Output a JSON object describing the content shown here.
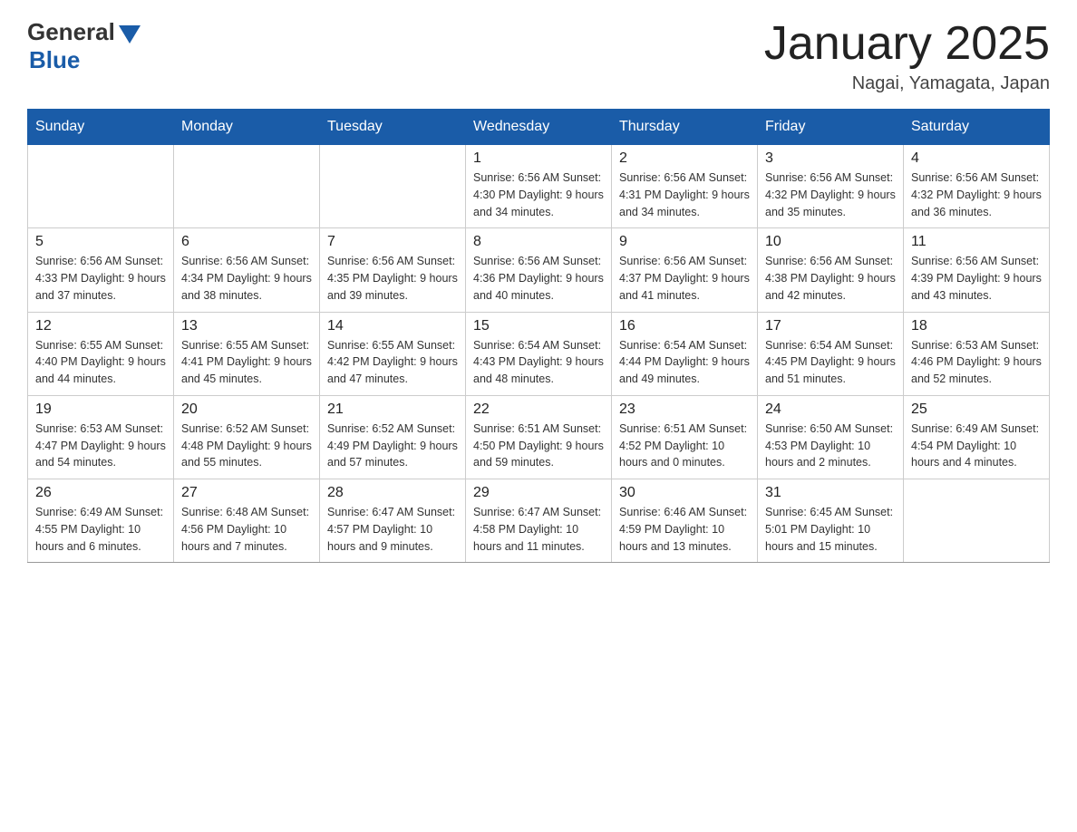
{
  "header": {
    "logo_general": "General",
    "logo_blue": "Blue",
    "title": "January 2025",
    "location": "Nagai, Yamagata, Japan"
  },
  "weekdays": [
    "Sunday",
    "Monday",
    "Tuesday",
    "Wednesday",
    "Thursday",
    "Friday",
    "Saturday"
  ],
  "weeks": [
    [
      {
        "day": "",
        "info": ""
      },
      {
        "day": "",
        "info": ""
      },
      {
        "day": "",
        "info": ""
      },
      {
        "day": "1",
        "info": "Sunrise: 6:56 AM\nSunset: 4:30 PM\nDaylight: 9 hours\nand 34 minutes."
      },
      {
        "day": "2",
        "info": "Sunrise: 6:56 AM\nSunset: 4:31 PM\nDaylight: 9 hours\nand 34 minutes."
      },
      {
        "day": "3",
        "info": "Sunrise: 6:56 AM\nSunset: 4:32 PM\nDaylight: 9 hours\nand 35 minutes."
      },
      {
        "day": "4",
        "info": "Sunrise: 6:56 AM\nSunset: 4:32 PM\nDaylight: 9 hours\nand 36 minutes."
      }
    ],
    [
      {
        "day": "5",
        "info": "Sunrise: 6:56 AM\nSunset: 4:33 PM\nDaylight: 9 hours\nand 37 minutes."
      },
      {
        "day": "6",
        "info": "Sunrise: 6:56 AM\nSunset: 4:34 PM\nDaylight: 9 hours\nand 38 minutes."
      },
      {
        "day": "7",
        "info": "Sunrise: 6:56 AM\nSunset: 4:35 PM\nDaylight: 9 hours\nand 39 minutes."
      },
      {
        "day": "8",
        "info": "Sunrise: 6:56 AM\nSunset: 4:36 PM\nDaylight: 9 hours\nand 40 minutes."
      },
      {
        "day": "9",
        "info": "Sunrise: 6:56 AM\nSunset: 4:37 PM\nDaylight: 9 hours\nand 41 minutes."
      },
      {
        "day": "10",
        "info": "Sunrise: 6:56 AM\nSunset: 4:38 PM\nDaylight: 9 hours\nand 42 minutes."
      },
      {
        "day": "11",
        "info": "Sunrise: 6:56 AM\nSunset: 4:39 PM\nDaylight: 9 hours\nand 43 minutes."
      }
    ],
    [
      {
        "day": "12",
        "info": "Sunrise: 6:55 AM\nSunset: 4:40 PM\nDaylight: 9 hours\nand 44 minutes."
      },
      {
        "day": "13",
        "info": "Sunrise: 6:55 AM\nSunset: 4:41 PM\nDaylight: 9 hours\nand 45 minutes."
      },
      {
        "day": "14",
        "info": "Sunrise: 6:55 AM\nSunset: 4:42 PM\nDaylight: 9 hours\nand 47 minutes."
      },
      {
        "day": "15",
        "info": "Sunrise: 6:54 AM\nSunset: 4:43 PM\nDaylight: 9 hours\nand 48 minutes."
      },
      {
        "day": "16",
        "info": "Sunrise: 6:54 AM\nSunset: 4:44 PM\nDaylight: 9 hours\nand 49 minutes."
      },
      {
        "day": "17",
        "info": "Sunrise: 6:54 AM\nSunset: 4:45 PM\nDaylight: 9 hours\nand 51 minutes."
      },
      {
        "day": "18",
        "info": "Sunrise: 6:53 AM\nSunset: 4:46 PM\nDaylight: 9 hours\nand 52 minutes."
      }
    ],
    [
      {
        "day": "19",
        "info": "Sunrise: 6:53 AM\nSunset: 4:47 PM\nDaylight: 9 hours\nand 54 minutes."
      },
      {
        "day": "20",
        "info": "Sunrise: 6:52 AM\nSunset: 4:48 PM\nDaylight: 9 hours\nand 55 minutes."
      },
      {
        "day": "21",
        "info": "Sunrise: 6:52 AM\nSunset: 4:49 PM\nDaylight: 9 hours\nand 57 minutes."
      },
      {
        "day": "22",
        "info": "Sunrise: 6:51 AM\nSunset: 4:50 PM\nDaylight: 9 hours\nand 59 minutes."
      },
      {
        "day": "23",
        "info": "Sunrise: 6:51 AM\nSunset: 4:52 PM\nDaylight: 10 hours\nand 0 minutes."
      },
      {
        "day": "24",
        "info": "Sunrise: 6:50 AM\nSunset: 4:53 PM\nDaylight: 10 hours\nand 2 minutes."
      },
      {
        "day": "25",
        "info": "Sunrise: 6:49 AM\nSunset: 4:54 PM\nDaylight: 10 hours\nand 4 minutes."
      }
    ],
    [
      {
        "day": "26",
        "info": "Sunrise: 6:49 AM\nSunset: 4:55 PM\nDaylight: 10 hours\nand 6 minutes."
      },
      {
        "day": "27",
        "info": "Sunrise: 6:48 AM\nSunset: 4:56 PM\nDaylight: 10 hours\nand 7 minutes."
      },
      {
        "day": "28",
        "info": "Sunrise: 6:47 AM\nSunset: 4:57 PM\nDaylight: 10 hours\nand 9 minutes."
      },
      {
        "day": "29",
        "info": "Sunrise: 6:47 AM\nSunset: 4:58 PM\nDaylight: 10 hours\nand 11 minutes."
      },
      {
        "day": "30",
        "info": "Sunrise: 6:46 AM\nSunset: 4:59 PM\nDaylight: 10 hours\nand 13 minutes."
      },
      {
        "day": "31",
        "info": "Sunrise: 6:45 AM\nSunset: 5:01 PM\nDaylight: 10 hours\nand 15 minutes."
      },
      {
        "day": "",
        "info": ""
      }
    ]
  ]
}
